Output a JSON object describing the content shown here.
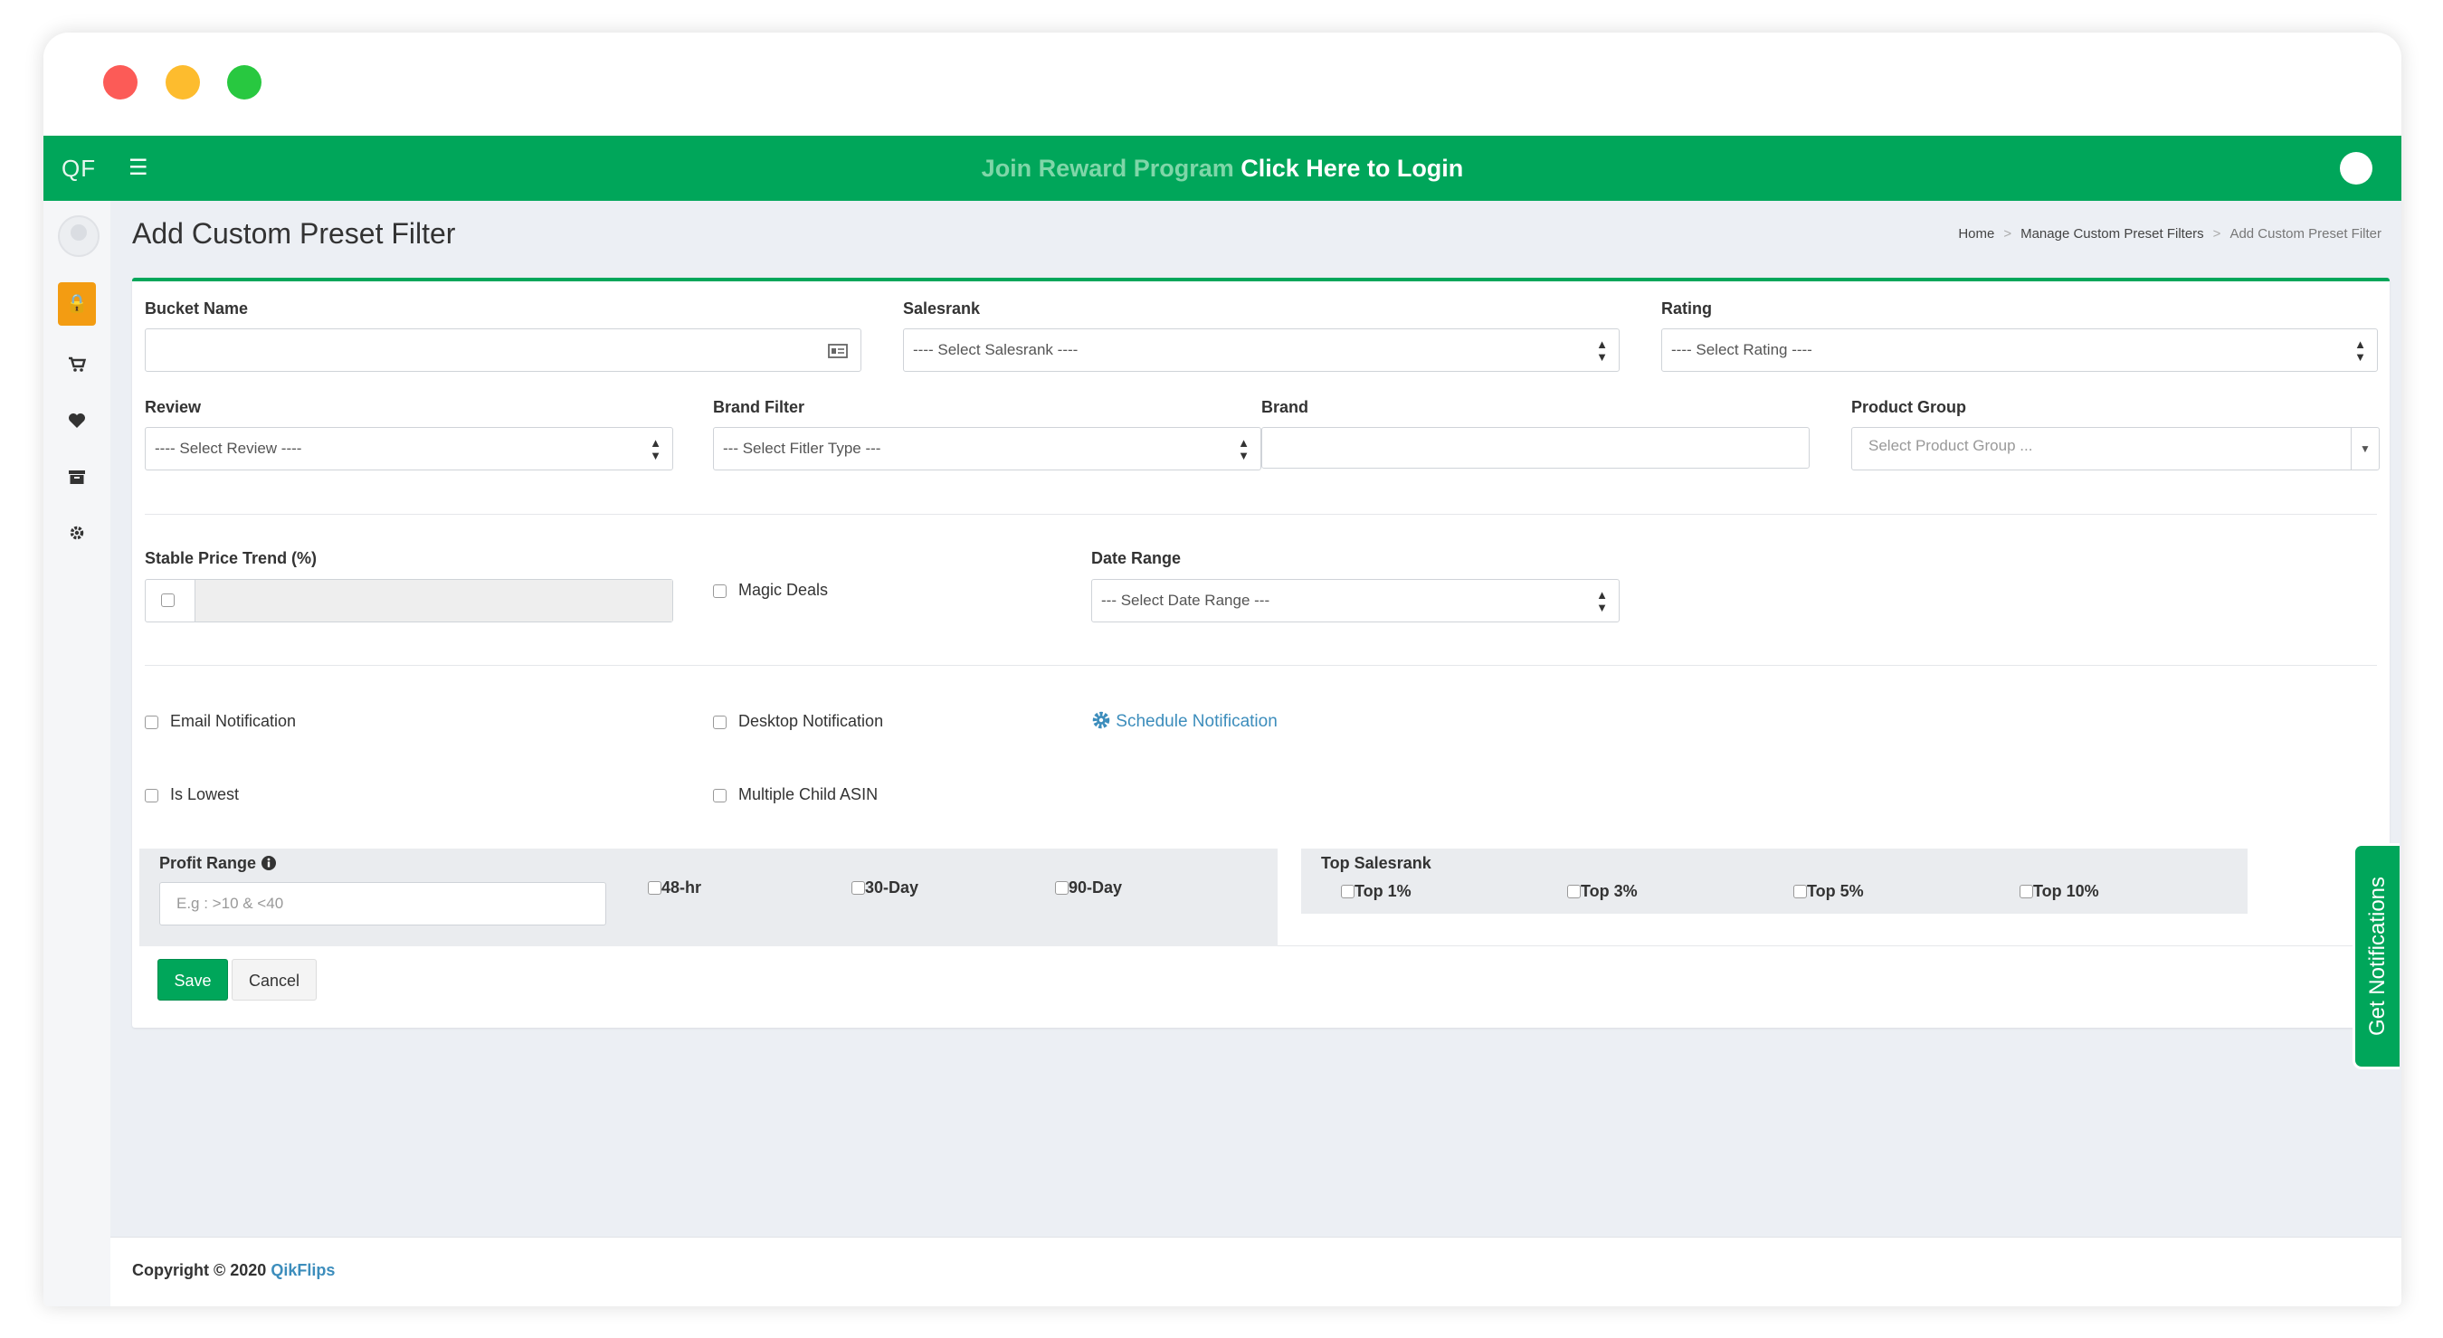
{
  "topbar": {
    "logo": "QF",
    "banner_faded": "Join Reward Program",
    "banner_link": "Click Here to Login"
  },
  "header": {
    "title": "Add Custom Preset Filter",
    "breadcrumb": [
      "Home",
      "Manage Custom Preset Filters",
      "Add Custom Preset Filter"
    ]
  },
  "form": {
    "bucket_name": {
      "label": "Bucket Name",
      "value": ""
    },
    "salesrank": {
      "label": "Salesrank",
      "selected": "---- Select Salesrank ----"
    },
    "rating": {
      "label": "Rating",
      "selected": "---- Select Rating ----"
    },
    "review": {
      "label": "Review",
      "selected": "---- Select Review ----"
    },
    "brand_filter": {
      "label": "Brand Filter",
      "selected": "--- Select Fitler Type ---"
    },
    "brand": {
      "label": "Brand",
      "value": ""
    },
    "product_group": {
      "label": "Product Group",
      "placeholder": "Select Product Group ..."
    },
    "stable_price_trend": {
      "label": "Stable Price Trend (%)"
    },
    "magic_deals": {
      "label": "Magic Deals"
    },
    "date_range": {
      "label": "Date Range",
      "selected": "--- Select Date Range ---"
    },
    "email_notification": {
      "label": "Email Notification"
    },
    "desktop_notification": {
      "label": "Desktop Notification"
    },
    "schedule_notification": {
      "label": "Schedule Notification"
    },
    "is_lowest": {
      "label": "Is Lowest"
    },
    "multiple_child_asin": {
      "label": "Multiple Child ASIN"
    },
    "profit_range": {
      "label": "Profit Range",
      "placeholder": "E.g : >10 & <40",
      "options": [
        "48-hr",
        "30-Day",
        "90-Day"
      ]
    },
    "top_salesrank": {
      "label": "Top Salesrank",
      "options": [
        "Top 1%",
        "Top 3%",
        "Top 5%",
        "Top 10%"
      ]
    },
    "save_label": "Save",
    "cancel_label": "Cancel"
  },
  "notif_tab": "Get Notifications",
  "footer": {
    "copyright": "Copyright © 2020",
    "brand": "QikFlips"
  },
  "colors": {
    "primary": "#00a65a",
    "warning": "#f39c12",
    "link": "#3c8dbc"
  }
}
